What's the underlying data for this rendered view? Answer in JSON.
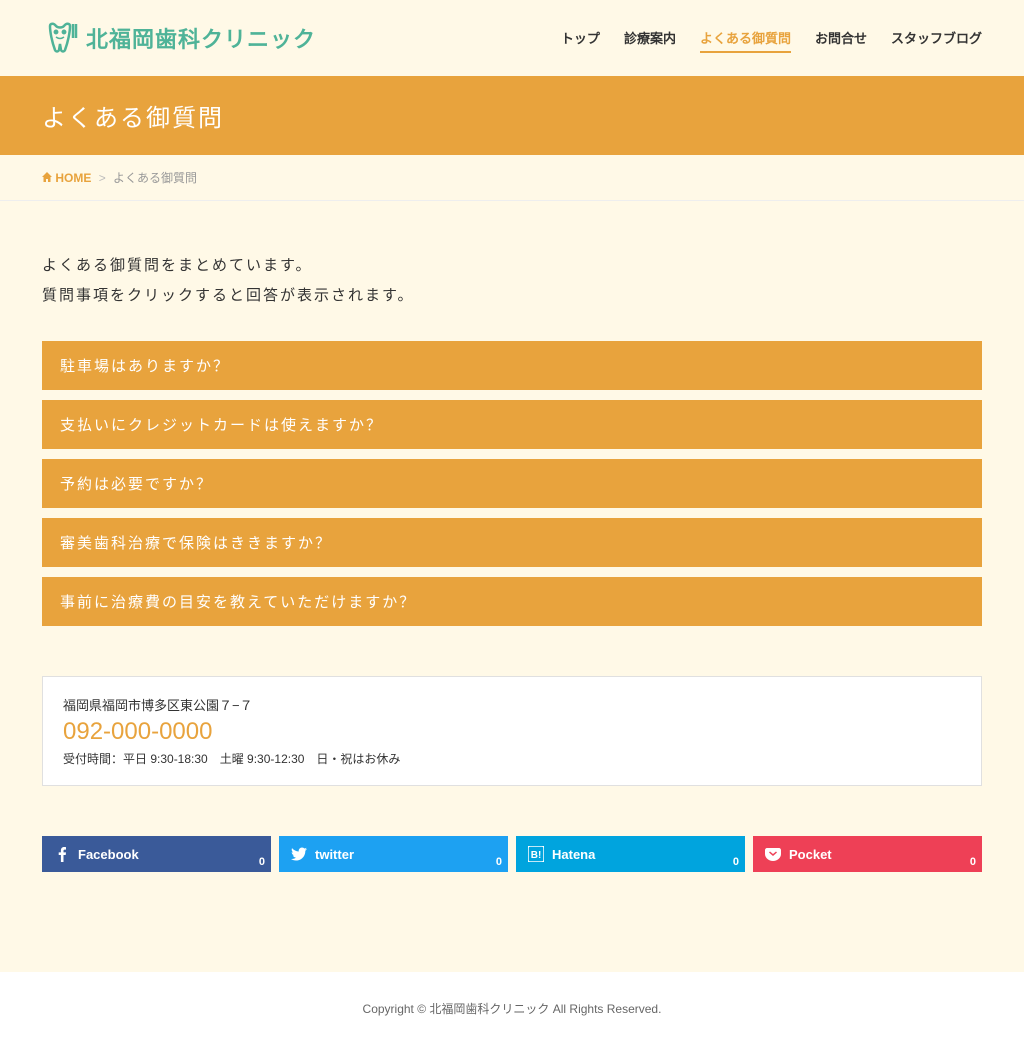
{
  "site": {
    "logo_text": "北福岡歯科クリニック"
  },
  "nav": {
    "items": [
      {
        "label": "トップ",
        "active": false
      },
      {
        "label": "診療案内",
        "active": false
      },
      {
        "label": "よくある御質問",
        "active": true
      },
      {
        "label": "お問合せ",
        "active": false
      },
      {
        "label": "スタッフブログ",
        "active": false
      }
    ]
  },
  "page_title": "よくある御質問",
  "breadcrumb": {
    "home_label": "HOME",
    "separator": ">",
    "current": "よくある御質問"
  },
  "intro": {
    "line1": "よくある御質問をまとめています。",
    "line2": "質問事項をクリックすると回答が表示されます。"
  },
  "faq": {
    "items": [
      {
        "question": "駐車場はありますか？"
      },
      {
        "question": "支払いにクレジットカードは使えますか？"
      },
      {
        "question": "予約は必要ですか？"
      },
      {
        "question": "審美歯科治療で保険はききますか？"
      },
      {
        "question": "事前に治療費の目安を教えていただけますか？"
      }
    ]
  },
  "contact": {
    "address": "福岡県福岡市博多区東公園７−７",
    "phone": "092-000-0000",
    "hours": "受付時間：平日 9:30-18:30　土曜 9:30-12:30　日・祝はお休み"
  },
  "social": {
    "facebook": {
      "label": "Facebook",
      "count": "0"
    },
    "twitter": {
      "label": "twitter",
      "count": "0"
    },
    "hatena": {
      "label": "Hatena",
      "count": "0"
    },
    "pocket": {
      "label": "Pocket",
      "count": "0"
    }
  },
  "footer": {
    "copyright": "Copyright © 北福岡歯科クリニック All Rights Reserved."
  }
}
